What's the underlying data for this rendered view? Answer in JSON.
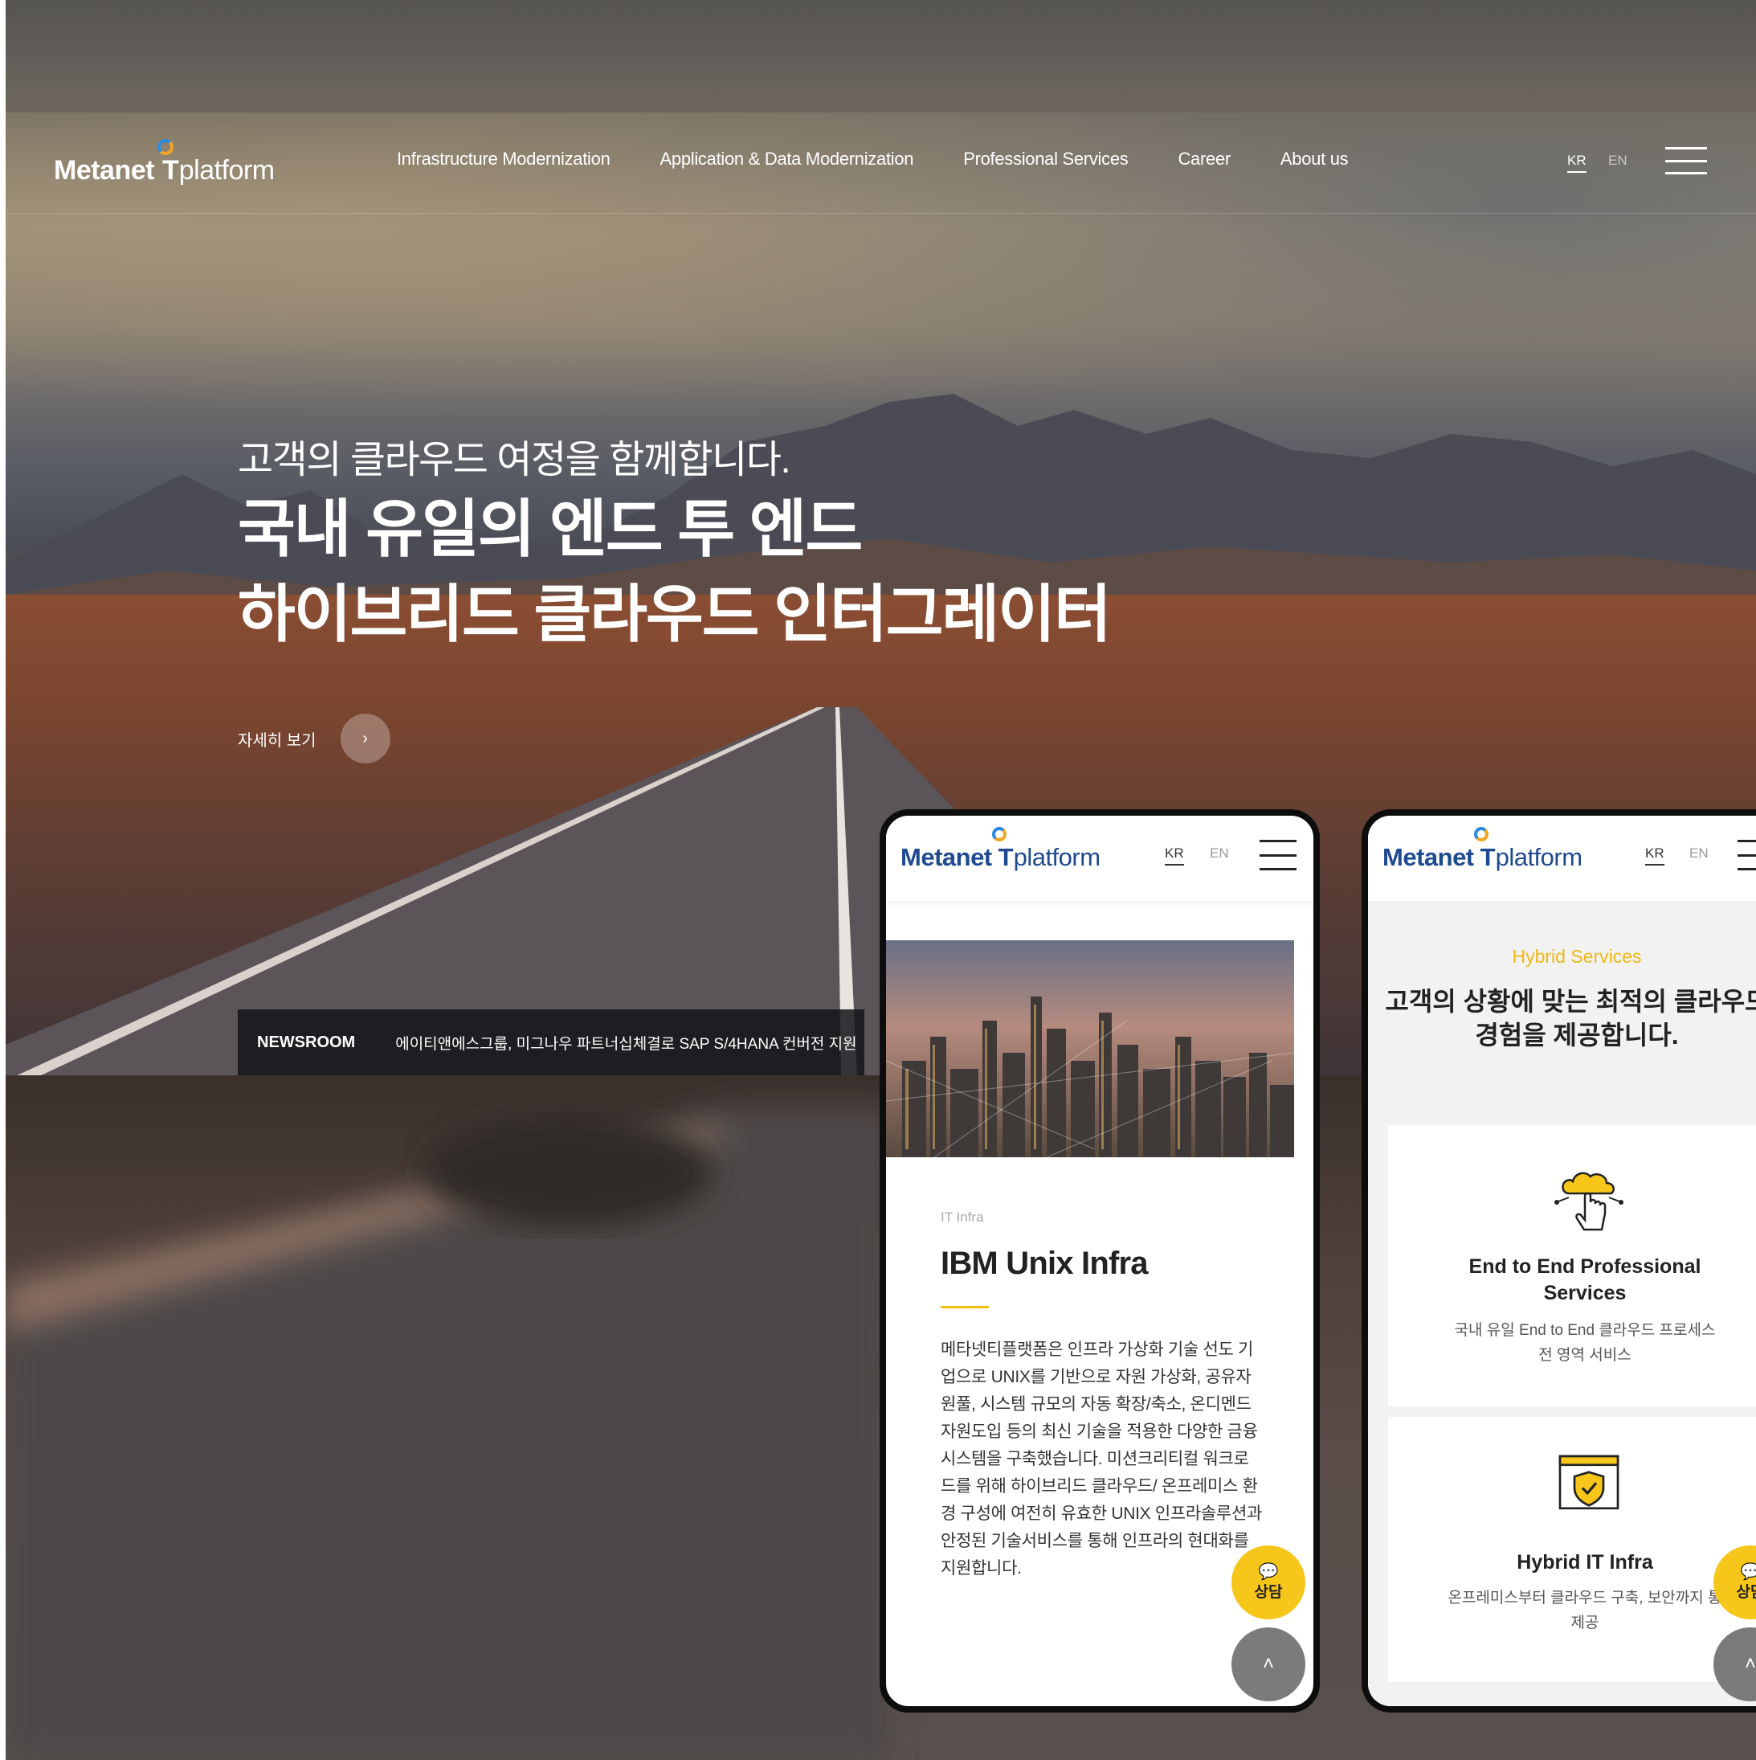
{
  "header": {
    "logo": {
      "metanet": "Metanet",
      "t": "T",
      "platform": "platform"
    },
    "nav": [
      "Infrastructure Modernization",
      "Application & Data Modernization",
      "Professional Services",
      "Career",
      "About us"
    ],
    "lang_kr": "KR",
    "lang_en": "EN"
  },
  "hero": {
    "subtitle": "고객의 클라우드 여정을 함께합니다.",
    "title_line1": "국내 유일의 엔드 투 엔드",
    "title_line2": "하이브리드 클라우드 인터그레이터",
    "more_label": "자세히 보기",
    "more_icon": "chevron-right-icon"
  },
  "newsroom": {
    "label": "NEWSROOM",
    "headline": "에이티앤에스그룹, 미그나우 파트너십체결로 SAP S/4HANA 컨버전 지원"
  },
  "phone1": {
    "lang_kr": "KR",
    "lang_en": "EN",
    "tag": "IT Infra",
    "title": "IBM Unix Infra",
    "body": "메타넷티플랫폼은 인프라 가상화 기술 선도 기업으로 UNIX를 기반으로 자원 가상화, 공유자원풀, 시스템 규모의 자동 확장/축소, 온디멘드 자원도입 등의 최신 기술을 적용한 다양한 금융시스템을 구축했습니다. 미션크리티컬 워크로드를 위해 하이브리드 클라우드/ 온프레미스 환경 구성에 여전히 유효한 UNIX 인프라솔루션과 안정된 기술서비스를 통해 인프라의 현대화를 지원합니다.",
    "chat_label": "상담"
  },
  "phone2": {
    "lang_kr": "KR",
    "lang_en": "EN",
    "eyebrow": "Hybrid Services",
    "heading_line1": "고객의 상황에 맞는 최적의 클라우드",
    "heading_line2": "경험을 제공합니다.",
    "card1": {
      "title_line1": "End to End Professional",
      "title_line2": "Services",
      "desc_line1": "국내 유일 End to End 클라우드 프로세스",
      "desc_line2": "전 영역 서비스",
      "icon": "cloud-hand-icon"
    },
    "card2": {
      "title": "Hybrid IT Infra",
      "desc_line1": "온프레미스부터 클라우드 구축, 보안까지 통",
      "desc_line2": "제공",
      "icon": "shield-check-icon"
    },
    "chat_label": "상담"
  },
  "colors": {
    "accent_yellow": "#f7c61a",
    "brand_blue": "#1f4a8f",
    "eyebrow_gold": "#f0b816"
  }
}
